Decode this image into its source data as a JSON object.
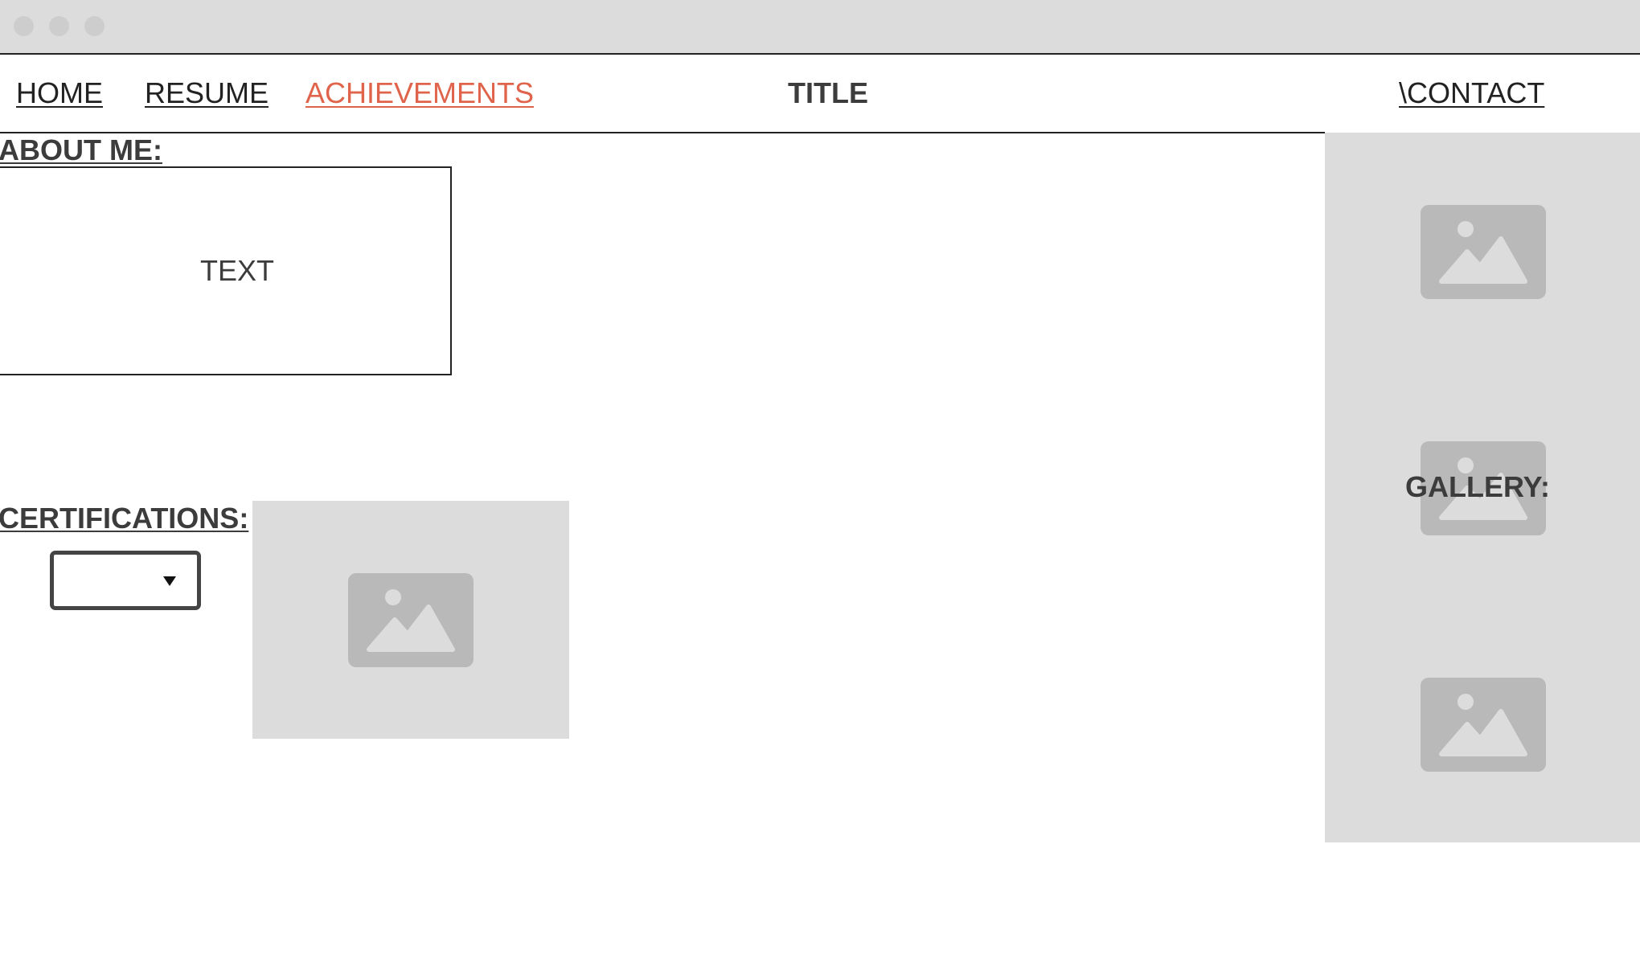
{
  "nav": {
    "home": "HOME",
    "resume": "RESUME",
    "achievements": "ACHIEVEMENTS",
    "title": "TITLE",
    "contact": "\\CONTACT"
  },
  "about": {
    "heading": "ABOUT ME:",
    "text": "TEXT"
  },
  "certifications": {
    "heading": "CERTIFICATIONS:",
    "dropdown_value": ""
  },
  "gallery": {
    "label": "GALLERY:"
  },
  "icons": {
    "image_placeholder": "image-placeholder-icon"
  },
  "colors": {
    "active_link": "#e0644b",
    "placeholder_bg": "#dcdcdc",
    "placeholder_icon": "#b9b9b9"
  }
}
